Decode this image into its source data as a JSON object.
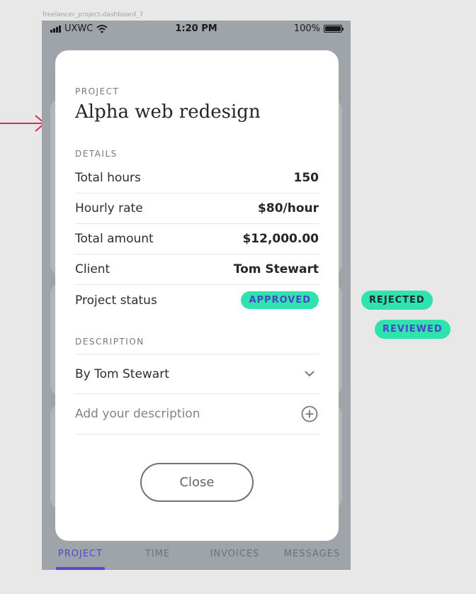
{
  "canvas": {
    "label": "freelancer_project-dashboard_7"
  },
  "status_bar": {
    "carrier": "UXWC",
    "time": "1:20 PM",
    "battery": "100%"
  },
  "modal": {
    "project_label": "PROJECT",
    "project_title": "Alpha web redesign",
    "details_label": "DETAILS",
    "details": [
      {
        "label": "Total hours",
        "value": "150"
      },
      {
        "label": "Hourly rate",
        "value": "$80/hour"
      },
      {
        "label": "Total amount",
        "value": "$12,000.00"
      },
      {
        "label": "Client",
        "value": "Tom Stewart"
      }
    ],
    "status": {
      "label": "Project status",
      "value": "APPROVED"
    },
    "description_label": "DESCRIPTION",
    "author_row": "By Tom Stewart",
    "add_description": "Add your description",
    "close_label": "Close"
  },
  "status_variants": [
    {
      "label": "REJECTED",
      "text_color": "#1f2a30"
    },
    {
      "label": "REVIEWED",
      "text_color": "#4a45c9"
    }
  ],
  "tabs": [
    {
      "label": "PROJECT",
      "active": true
    },
    {
      "label": "TIME",
      "active": false
    },
    {
      "label": "INVOICES",
      "active": false
    },
    {
      "label": "MESSAGES",
      "active": false
    }
  ],
  "colors": {
    "accent": "#5248d4",
    "status_pill": "#2ee3ad",
    "arrow": "#e8245a",
    "phone_dim": "#9ea4a9"
  }
}
